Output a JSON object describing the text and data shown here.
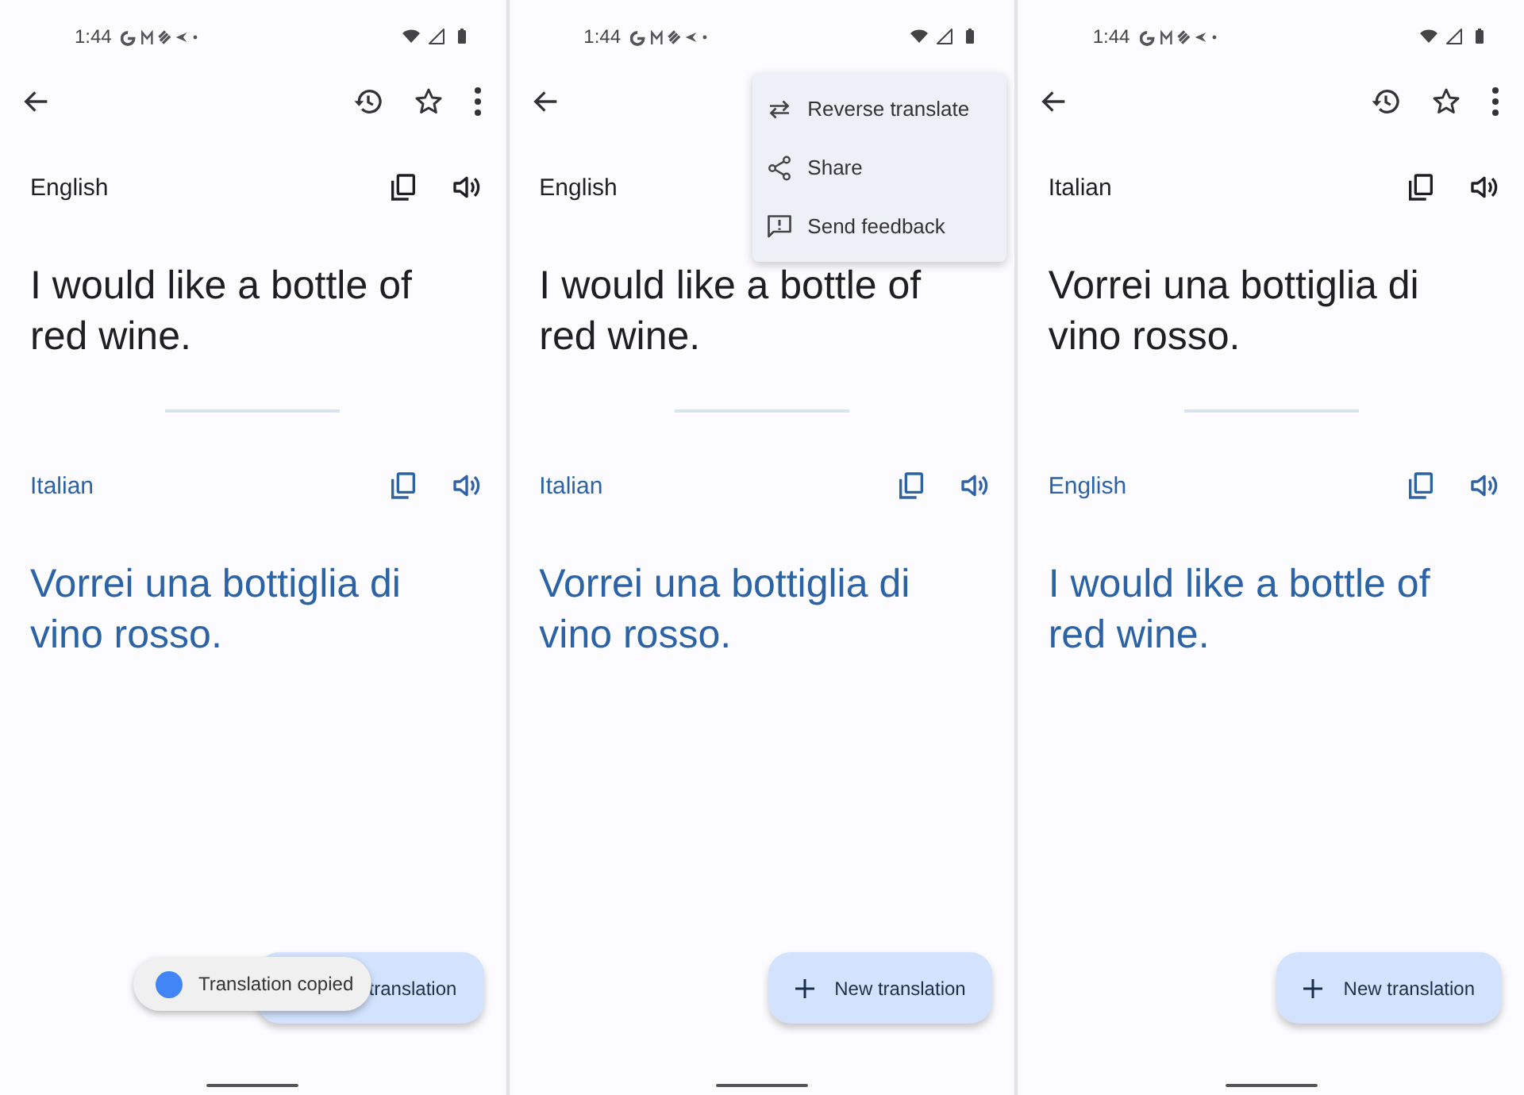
{
  "screens": [
    {
      "status": {
        "time": "1:44"
      },
      "source": {
        "language": "English",
        "text": "I would like a bottle of red wine."
      },
      "target": {
        "language": "Italian",
        "text": "Vorrei una bottiglia di vino rosso."
      },
      "fab": {
        "label": "translation",
        "icon": false
      },
      "snackbar": {
        "text": "Translation copied"
      }
    },
    {
      "status": {
        "time": "1:44"
      },
      "menu": [
        {
          "label": "Reverse translate",
          "kind": "swap"
        },
        {
          "label": "Share",
          "kind": "share"
        },
        {
          "label": "Send feedback",
          "kind": "feedback"
        }
      ],
      "source": {
        "language": "English",
        "text": "I would like a bottle of red wine."
      },
      "target": {
        "language": "Italian",
        "text": "Vorrei una bottiglia di vino rosso."
      },
      "fab": {
        "label": "New translation",
        "icon": true
      }
    },
    {
      "status": {
        "time": "1:44"
      },
      "source": {
        "language": "Italian",
        "text": "Vorrei una bottiglia di vino rosso."
      },
      "target": {
        "language": "English",
        "text": "I would like a bottle of red wine."
      },
      "fab": {
        "label": "New translation",
        "icon": true
      }
    }
  ]
}
